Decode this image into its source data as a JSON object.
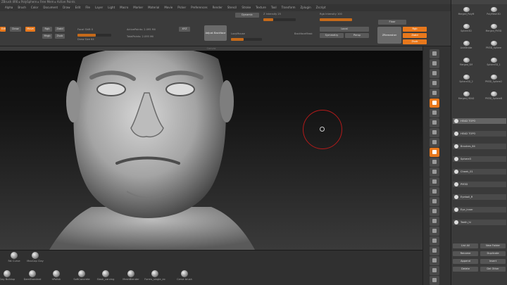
{
  "title_bar": "ZBrush 4R6 ▸ PolySphere ▸ Free Mem ▸ Active Points",
  "menu": [
    "Alpha",
    "Brush",
    "Color",
    "Document",
    "Draw",
    "Edit",
    "File",
    "Layer",
    "Light",
    "Macro",
    "Marker",
    "Material",
    "Movie",
    "Picker",
    "Preferences",
    "Render",
    "Stencil",
    "Stroke",
    "Texture",
    "Tool",
    "Transform",
    "Zplugin",
    "Zscript"
  ],
  "shelf": {
    "edit_label": "Edit",
    "draw_label": "Draw",
    "move_label": "Move",
    "rgb_label": "Rgb",
    "mrgb_label": "Mrgb",
    "zadd_label": "Zadd",
    "zsub_label": "Zsub",
    "focal_label": "Focal Shift 0",
    "draw_size_label": "Draw Size 64",
    "active_points": "ActivePoints: 2.095 Mil",
    "total_points": "TotalPoints: 2.095 Mil",
    "adjust_label": "Adjust Backface",
    "z_intensity": "Z Intensity 25",
    "rgb_intensity": "Rgb Intensity 100",
    "dyn_label": "Dynamic",
    "lazy_label": "LazyMouse",
    "backface_label": "BackfaceMask",
    "local_label": "Local",
    "sym_label": "Symmetry",
    "xyz_label": "XYZ",
    "zrem_label": "ZRemesher",
    "persp_label": "Persp",
    "floor_label": "Floor"
  },
  "viewport_label": "Canvas",
  "brushes": {
    "row1": [
      "Fat Curve",
      "MaxCap Clay"
    ],
    "row2": [
      "Clay Buildup",
      "DamStandard",
      "hPolish",
      "SoftConcrete",
      "Slash_carving",
      "MeshBlender",
      "Forms_single_ex",
      "Cerve brush"
    ]
  },
  "right_panel": {
    "tool_cells": [
      "Merged_PolyM",
      "PolyMesh3D",
      "Sphere3D",
      "Merged_PM3D",
      "LineStroke",
      "PM3D_Sphere",
      "Merged_SM",
      "Sphere3D_1",
      "Sphere3D_2",
      "PM3D_Sphere2",
      "Merged_HEAD",
      "PM3D_SphereB"
    ],
    "subtools": [
      "HEAD TOPO",
      "HEAD TOPO",
      "Brushes_64",
      "Sphere3",
      "Cheek_01",
      "PM3D",
      "Eyeball_R",
      "Eye_Inner",
      "Teeth_hi"
    ],
    "buttons": [
      "List All",
      "New Folder",
      "Rename",
      "Duplicate",
      "Append",
      "Insert",
      "Delete",
      "Del Other"
    ]
  }
}
